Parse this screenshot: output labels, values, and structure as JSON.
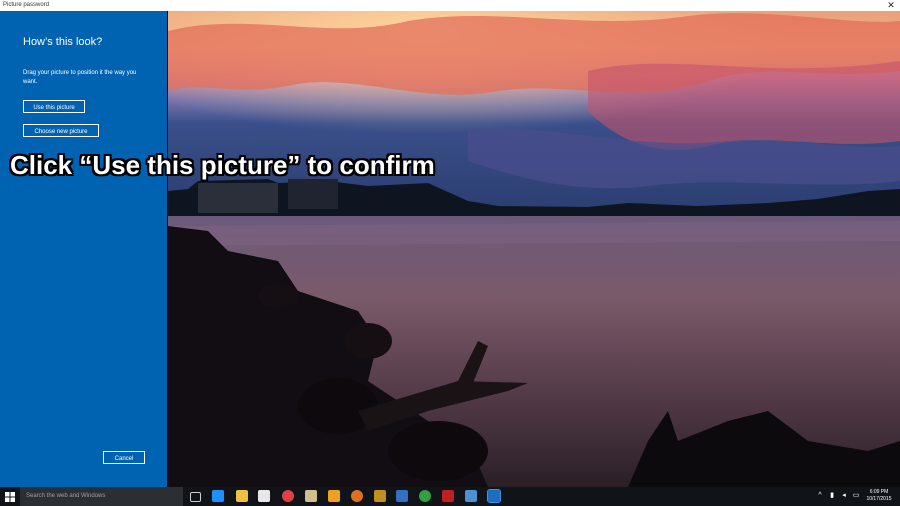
{
  "window": {
    "title": "Picture password",
    "close_glyph": "✕"
  },
  "panel": {
    "heading": "How’s this look?",
    "description": "Drag your picture to position it the way you want.",
    "use_button": "Use this picture",
    "choose_button": "Choose new picture",
    "cancel_button": "Cancel",
    "color": "#0063b1"
  },
  "overlay": {
    "caption": "Click “Use this picture” to confirm"
  },
  "taskbar": {
    "search_placeholder": "Search the web and Windows",
    "clock_time": "6:09 PM",
    "clock_date": "10/17/2015",
    "icons": [
      "task-view-icon",
      "edge-icon",
      "file-explorer-icon",
      "store-icon",
      "chrome-icon",
      "folder-icon",
      "media-icon",
      "app-icon",
      "app-icon",
      "app-icon",
      "app-icon",
      "filezilla-icon",
      "app-icon",
      "settings-icon"
    ]
  }
}
